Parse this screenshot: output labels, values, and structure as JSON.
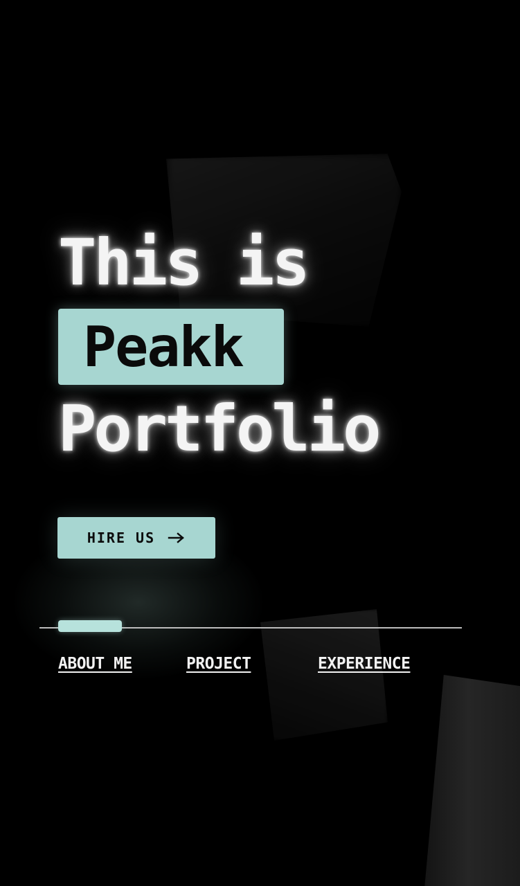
{
  "hero": {
    "line1": "This is",
    "highlight": "Peakk",
    "line3": "Portfolio"
  },
  "cta": {
    "label": "HIRE US",
    "icon": "arrow-right-icon"
  },
  "slider": {
    "active_index": 0
  },
  "nav": {
    "items": [
      {
        "label": "ABOUT ME"
      },
      {
        "label": "PROJECT"
      },
      {
        "label": "EXPERIENCE"
      }
    ]
  },
  "colors": {
    "background": "#000000",
    "accent": "#a7d6d1",
    "text": "#f4f4f4"
  }
}
